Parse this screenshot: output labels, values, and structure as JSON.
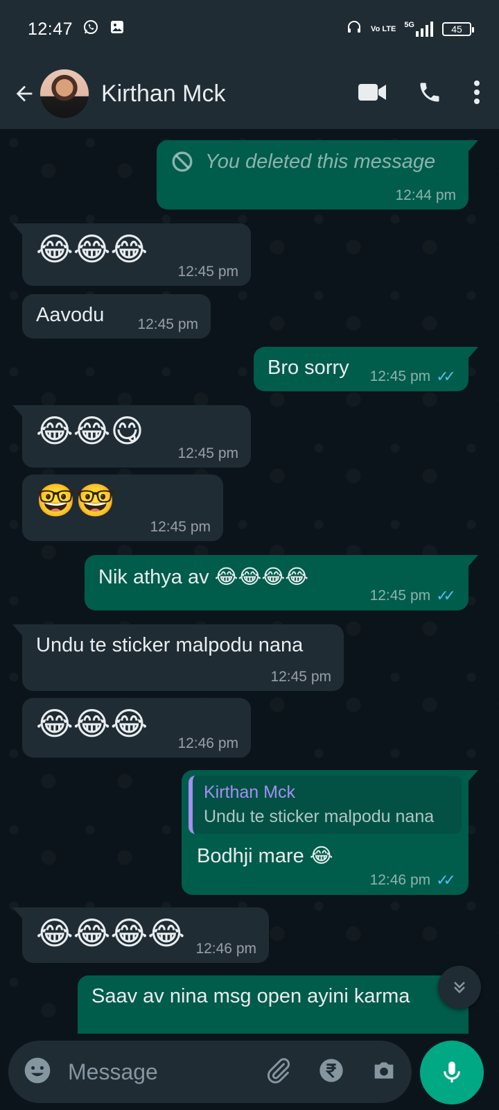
{
  "status_bar": {
    "time": "12:47",
    "battery": "45",
    "network": "5G",
    "volte_label": "Vo LTE"
  },
  "header": {
    "contact_name": "Kirthan Mck"
  },
  "messages": [
    {
      "dir": "out",
      "type": "deleted",
      "text": "You deleted this message",
      "time": "12:44 pm"
    },
    {
      "dir": "in",
      "type": "emoji",
      "text": "😂😂😂",
      "time": "12:45 pm"
    },
    {
      "dir": "in",
      "type": "text",
      "text": "Aavodu",
      "time": "12:45 pm"
    },
    {
      "dir": "out",
      "type": "text",
      "text": "Bro sorry",
      "time": "12:45 pm",
      "read": true
    },
    {
      "dir": "in",
      "type": "emoji",
      "text": "😂😂😋",
      "time": "12:45 pm"
    },
    {
      "dir": "in",
      "type": "emoji",
      "text": "🤓🤓",
      "time": "12:45 pm"
    },
    {
      "dir": "out",
      "type": "text",
      "text": "Nik athya av 😂😂😂😂",
      "time": "12:45 pm",
      "read": true
    },
    {
      "dir": "in",
      "type": "text",
      "text": "Undu te sticker malpodu nana",
      "time": "12:45 pm"
    },
    {
      "dir": "in",
      "type": "emoji",
      "text": "😂😂😂",
      "time": "12:46 pm"
    },
    {
      "dir": "out",
      "type": "reply",
      "quote_name": "Kirthan Mck",
      "quote_text": "Undu te sticker malpodu nana",
      "text": "Bodhji mare 😂",
      "time": "12:46 pm",
      "read": true
    },
    {
      "dir": "in",
      "type": "emoji",
      "text": "😂😂😂😂",
      "time": "12:46 pm"
    },
    {
      "dir": "out",
      "type": "text",
      "text": "Saav av nina msg open ayini karma"
    }
  ],
  "input": {
    "placeholder": "Message"
  },
  "colors": {
    "accent": "#00a884",
    "outgoing": "#005c4b",
    "incoming": "#1f2c34",
    "read_ticks": "#53bdeb",
    "quote_name": "#a48ff2"
  }
}
